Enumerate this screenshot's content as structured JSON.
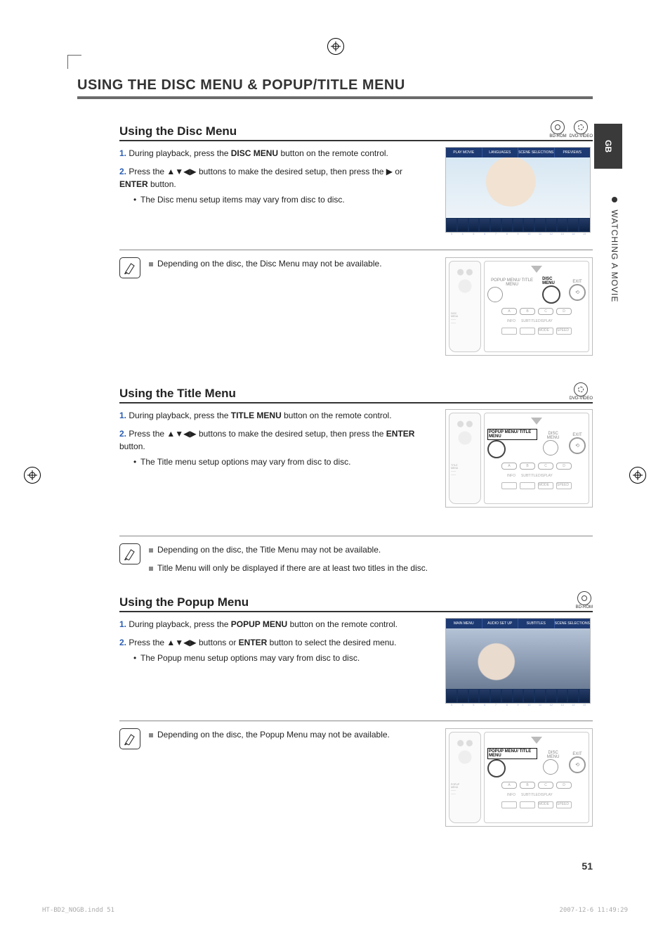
{
  "language_tab": "GB",
  "side_label": "WATCHING A MOVIE",
  "page_number": "51",
  "footer_left": "HT-BD2_NOGB.indd   51",
  "footer_right": "2007-12-6   11:49:29",
  "heading": "USING THE DISC MENU & POPUP/TITLE MENU",
  "disc_section": {
    "title": "Using the Disc Menu",
    "icons": [
      "BD-ROM",
      "DVD-VIDEO"
    ],
    "step1_num": "1.",
    "step1_a": "During playback, press the ",
    "step1_b": "DISC MENU",
    "step1_c": " button on the remote control.",
    "step2_num": "2.",
    "step2_a": "Press the ",
    "step2_arrows": "▲▼◀▶",
    "step2_b": " buttons to make the desired setup, then press the ",
    "step2_play": "▶",
    "step2_c": " or ",
    "step2_d": "ENTER",
    "step2_e": " button.",
    "step2_sub": "The Disc menu setup items may vary from disc to disc.",
    "note": "Depending on the disc, the Disc Menu may not be available.",
    "movie_tabs": [
      "PLAY MOVIE",
      "LANGUAGES",
      "SCENE SELECTIONS",
      "PREVIEWS"
    ],
    "thumbnails": [
      "3",
      "4",
      "5",
      "6",
      "7",
      "8",
      "9",
      "10",
      "11",
      "12",
      "13",
      "14",
      "15"
    ]
  },
  "remote_disc": {
    "top_left": "POPUP MENU/\nTITLE MENU",
    "center": "DISC MENU",
    "right": "EXIT",
    "pills": [
      "A",
      "B",
      "C",
      "D"
    ],
    "labels": [
      "INFO",
      "SUBTITLE",
      "DISPLAY",
      ""
    ],
    "rects": [
      "",
      "",
      "MODE",
      "SPEED"
    ]
  },
  "title_section": {
    "title": "Using the Title Menu",
    "icons": [
      "DVD-VIDEO"
    ],
    "step1_num": "1.",
    "step1_a": "During playback, press the ",
    "step1_b": "TITLE MENU",
    "step1_c": " button on the remote control.",
    "step2_num": "2.",
    "step2_a": "Press the ",
    "step2_arrows": "▲▼◀▶",
    "step2_b": " buttons to make the desired setup, then press the ",
    "step2_d": "ENTER",
    "step2_e": " button.",
    "step2_sub": "The Title menu setup options may vary from disc to disc.",
    "note1": "Depending on the disc, the Title Menu may not be available.",
    "note2": "Title Menu will only be displayed if there are at least two titles in the disc."
  },
  "remote_title": {
    "top_left": "POPUP MENU/\nTITLE MENU",
    "center": "DISC MENU",
    "right": "EXIT",
    "pills": [
      "A",
      "B",
      "C",
      "D"
    ],
    "labels": [
      "INFO",
      "SUBTITLE",
      "DISPLAY",
      ""
    ],
    "rects": [
      "",
      "",
      "MODE",
      "SPEED"
    ]
  },
  "popup_section": {
    "title": "Using the Popup Menu",
    "icons": [
      "BD-ROM"
    ],
    "step1_num": "1.",
    "step1_a": "During playback, press the ",
    "step1_b": "POPUP MENU",
    "step1_c": " button on the remote control.",
    "step2_num": "2.",
    "step2_a": "Press the ",
    "step2_arrows": "▲▼◀▶",
    "step2_b": " buttons or ",
    "step2_d": "ENTER",
    "step2_e": " button to select the desired menu.",
    "step2_sub": "The Popup menu setup options may vary from disc to disc.",
    "note": "Depending on the disc, the Popup Menu may not be available.",
    "movie_tabs": [
      "MAIN MENU",
      "AUDIO SET UP",
      "SUBTITLES",
      "SCENE SELECTIONS"
    ],
    "thumbnails": [
      "3",
      "4",
      "5",
      "6",
      "7",
      "8",
      "9",
      "10",
      "11",
      "12",
      "13",
      "14",
      "15"
    ]
  },
  "remote_popup": {
    "top_left": "POPUP MENU/\nTITLE MENU",
    "center": "DISC MENU",
    "right": "EXIT",
    "pills": [
      "A",
      "B",
      "C",
      "D"
    ],
    "labels": [
      "INFO",
      "SUBTITLE",
      "DISPLAY",
      ""
    ],
    "rects": [
      "",
      "",
      "MODE",
      "SPEED"
    ]
  }
}
